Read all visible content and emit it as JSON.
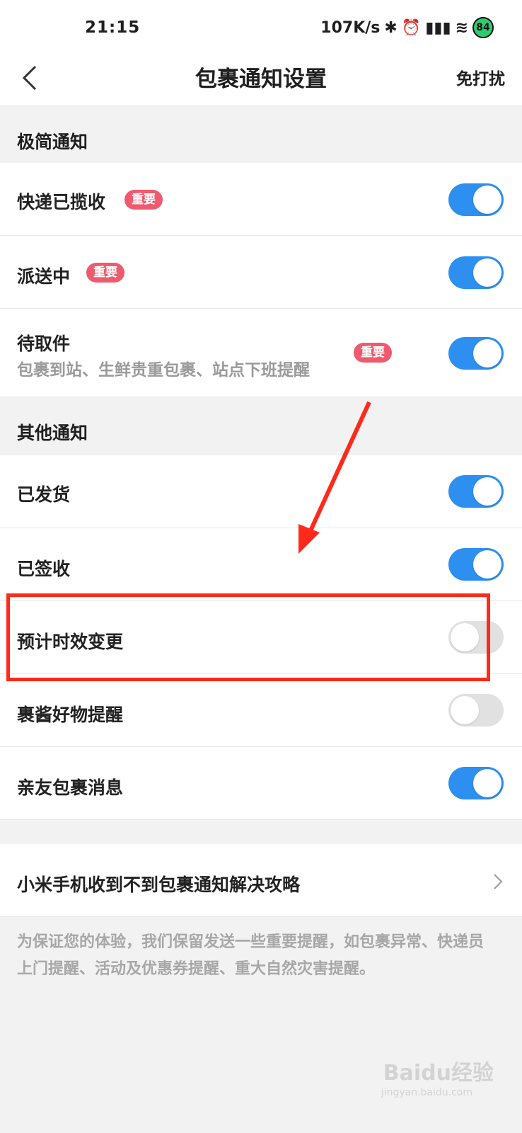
{
  "status_bar": {
    "time": "21:15",
    "net_speed": "107K/s",
    "battery": "84"
  },
  "nav": {
    "title": "包裹通知设置",
    "action": "免打扰"
  },
  "sections": {
    "minimal": {
      "title": "极简通知"
    },
    "other": {
      "title": "其他通知"
    }
  },
  "rows": {
    "collected": {
      "label": "快递已揽收",
      "badge": "重要",
      "toggle": "on"
    },
    "delivering": {
      "label": "派送中",
      "badge": "重要",
      "toggle": "on"
    },
    "pickup": {
      "label": "待取件",
      "sub": "包裹到站、生鲜贵重包裹、站点下班提醒",
      "badge": "重要",
      "toggle": "on"
    },
    "shipped": {
      "label": "已发货",
      "toggle": "on"
    },
    "signed": {
      "label": "已签收",
      "toggle": "on"
    },
    "eta_change": {
      "label": "预计时效变更",
      "toggle": "off"
    },
    "goods_remind": {
      "label": "裹酱好物提醒",
      "toggle": "off"
    },
    "family": {
      "label": "亲友包裹消息",
      "toggle": "on"
    },
    "xiaomi_guide": {
      "label": "小米手机收到不到包裹通知解决攻略"
    }
  },
  "footer": {
    "note": "为保证您的体验，我们保留发送一些重要提醒，如包裹异常、快递员上门提醒、活动及优惠券提醒、重大自然灾害提醒。"
  },
  "watermark": {
    "brand": "Baidu经验",
    "url": "jingyan.baidu.com"
  },
  "colors": {
    "toggle_on": "#2d8ff0",
    "badge": "#ef5b6e",
    "annotation": "#ff2a1a"
  }
}
